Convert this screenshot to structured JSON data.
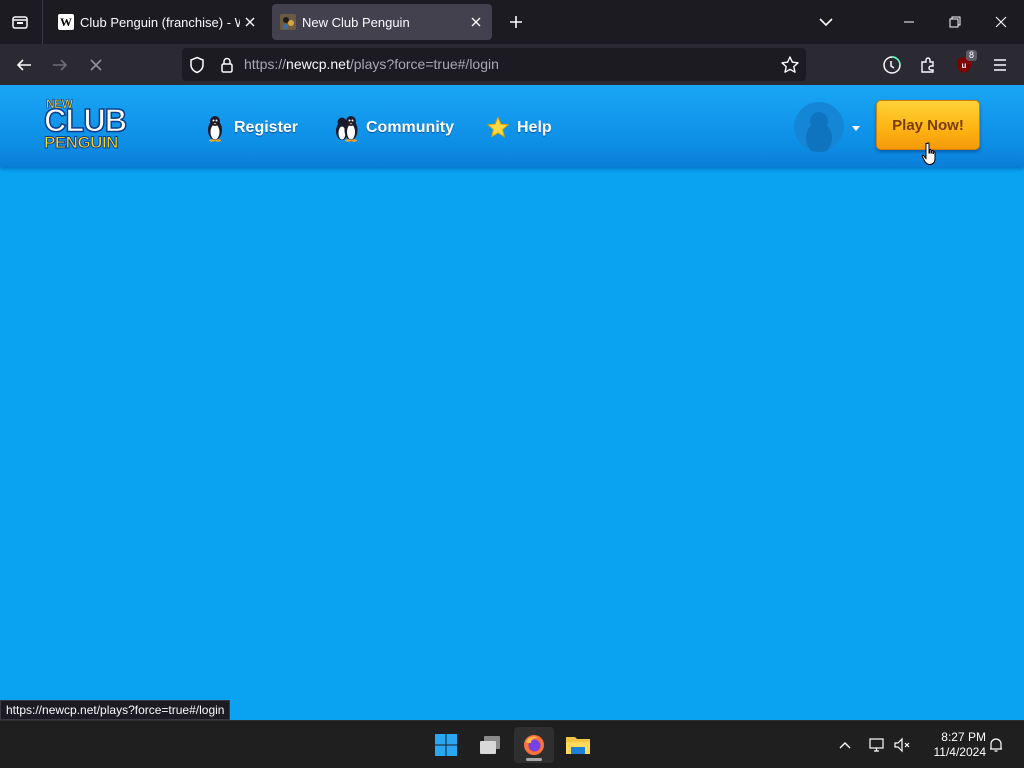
{
  "browser": {
    "tabs": [
      {
        "title": "Club Penguin (franchise) - Wiki",
        "favicon": "wikipedia-icon",
        "active": false
      },
      {
        "title": "New Club Penguin",
        "favicon": "new-club-penguin-icon",
        "active": true
      }
    ],
    "url": {
      "scheme": "https://",
      "host": "newcp.net",
      "path": "/plays?force=true#/login"
    },
    "extension_badge": "8",
    "status_link": "https://newcp.net/plays?force=true#/login"
  },
  "site": {
    "logo": {
      "top": "NEW",
      "main": "CLUB",
      "bottom": "PENGUIN"
    },
    "nav": [
      {
        "label": "Register",
        "icon": "penguin-icon"
      },
      {
        "label": "Community",
        "icon": "penguins-group-icon"
      },
      {
        "label": "Help",
        "icon": "star-icon"
      }
    ],
    "play_button": "Play Now!",
    "colors": {
      "background": "#0aa3f2",
      "header": "#0d8fe6",
      "play_button": "#ffb514"
    }
  },
  "taskbar": {
    "time": "8:27 PM",
    "date": "11/4/2024"
  }
}
